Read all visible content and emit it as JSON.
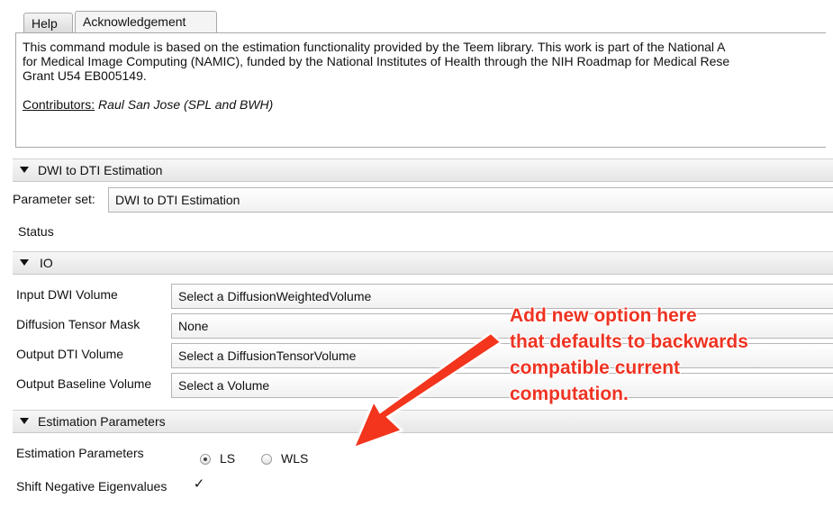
{
  "tabs": [
    {
      "label": "Help",
      "active": false
    },
    {
      "label": "Acknowledgement",
      "active": true
    }
  ],
  "acknowledgement": {
    "lines": [
      "This command module is based on the estimation functionality provided by the Teem library. This work is part of the National A",
      "for Medical Image Computing (NAMIC), funded by the National Institutes of Health through the NIH Roadmap for Medical Rese",
      "Grant U54 EB005149."
    ],
    "contributors_label": "Contributors:",
    "contributors_names": "Raul San Jose (SPL and BWH)"
  },
  "sections": {
    "dwi": "DWI to DTI Estimation",
    "io": "IO",
    "estimation": "Estimation Parameters"
  },
  "parameter_set": {
    "label": "Parameter set:",
    "value": "DWI to DTI Estimation"
  },
  "status_label": "Status",
  "io": {
    "input_dwi": {
      "label": "Input DWI Volume",
      "value": "Select a DiffusionWeightedVolume"
    },
    "mask": {
      "label": "Diffusion Tensor Mask",
      "value": "None"
    },
    "output_dti": {
      "label": "Output DTI Volume",
      "value": "Select a DiffusionTensorVolume"
    },
    "output_baseline": {
      "label": "Output Baseline Volume",
      "value": "Select a Volume"
    }
  },
  "estimation": {
    "label": "Estimation Parameters",
    "options": [
      {
        "label": "LS",
        "selected": true
      },
      {
        "label": "WLS",
        "selected": false
      }
    ],
    "shift_label": "Shift Negative Eigenvalues",
    "shift_checked": true
  },
  "annotation": {
    "lines": [
      "Add new option here",
      "that defaults to backwards",
      "compatible current",
      "computation."
    ],
    "color": "#ee3322"
  }
}
